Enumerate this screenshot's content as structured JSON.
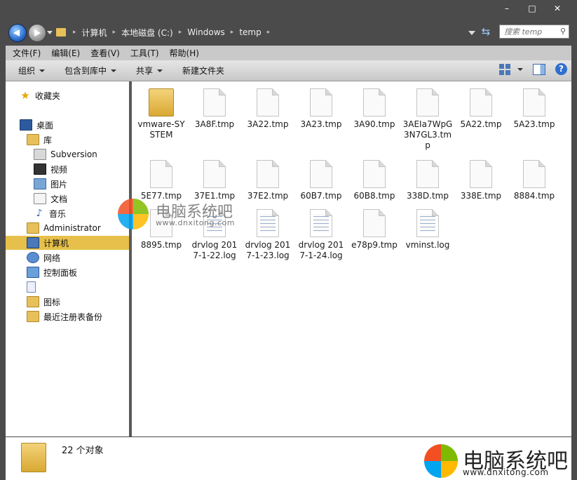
{
  "window_controls": {
    "minimize": "–",
    "maximize": "□",
    "close": "✕"
  },
  "breadcrumb": [
    "计算机",
    "本地磁盘 (C:)",
    "Windows",
    "temp"
  ],
  "search": {
    "placeholder": "搜索 temp"
  },
  "menu": [
    "文件(F)",
    "编辑(E)",
    "查看(V)",
    "工具(T)",
    "帮助(H)"
  ],
  "commands": [
    "组织",
    "包含到库中",
    "共享",
    "新建文件夹"
  ],
  "nav": {
    "favorites": "收藏夹",
    "desktop": "桌面",
    "library": "库",
    "subversion": "Subversion",
    "video": "视频",
    "pictures": "图片",
    "documents": "文档",
    "music": "音乐",
    "administrator": "Administrator",
    "computer": "计算机",
    "network": "网络",
    "control_panel": "控制面板",
    "icons_folder": "图标",
    "registry_backup": "最近注册表备份"
  },
  "files": [
    {
      "name": "vmware-SYSTEM",
      "type": "folder"
    },
    {
      "name": "3A8F.tmp",
      "type": "file"
    },
    {
      "name": "3A22.tmp",
      "type": "file"
    },
    {
      "name": "3A23.tmp",
      "type": "file"
    },
    {
      "name": "3A90.tmp",
      "type": "file"
    },
    {
      "name": "3AEIa7WpG3N7GL3.tmp",
      "type": "file"
    },
    {
      "name": "5A22.tmp",
      "type": "file"
    },
    {
      "name": "5A23.tmp",
      "type": "file"
    },
    {
      "name": "5E77.tmp",
      "type": "file"
    },
    {
      "name": "37E1.tmp",
      "type": "file"
    },
    {
      "name": "37E2.tmp",
      "type": "file"
    },
    {
      "name": "60B7.tmp",
      "type": "file"
    },
    {
      "name": "60B8.tmp",
      "type": "file"
    },
    {
      "name": "338D.tmp",
      "type": "file"
    },
    {
      "name": "338E.tmp",
      "type": "file"
    },
    {
      "name": "8884.tmp",
      "type": "file"
    },
    {
      "name": "8895.tmp",
      "type": "file"
    },
    {
      "name": "drvlog 2017-1-22.log",
      "type": "text"
    },
    {
      "name": "drvlog 2017-1-23.log",
      "type": "text"
    },
    {
      "name": "drvlog 2017-1-24.log",
      "type": "text"
    },
    {
      "name": "e78p9.tmp",
      "type": "file"
    },
    {
      "name": "vminst.log",
      "type": "text"
    }
  ],
  "status": {
    "count": "22 个对象"
  },
  "watermark": {
    "name": "电脑系统吧",
    "url": "www.dnxitong.com"
  },
  "colors": {
    "selection": "#e6c04a",
    "frame": "#4b4b4b",
    "logo": [
      "#f25022",
      "#7fba00",
      "#00a4ef",
      "#ffb900"
    ]
  }
}
